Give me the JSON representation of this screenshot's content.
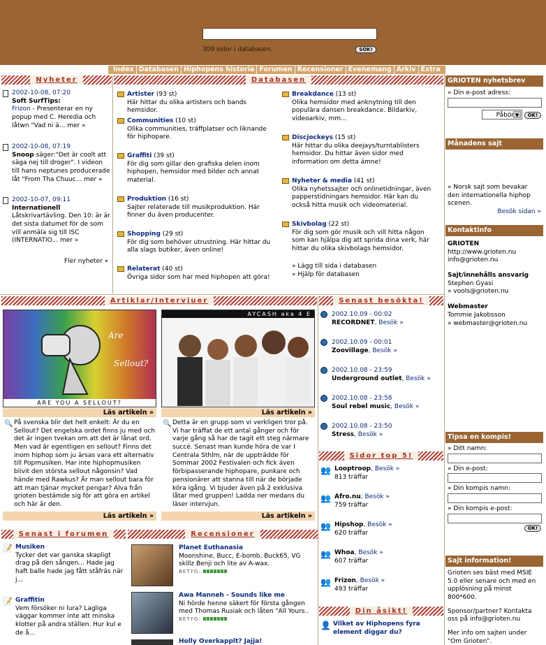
{
  "header": {
    "search_placeholder": "",
    "db_count": "309 sidor i databasen.",
    "search_button": "SÖK!"
  },
  "nav": [
    "Index",
    "Databasen",
    "Hiphopens historia",
    "Forumen",
    "Recensioner",
    "Evenemang",
    "Arkiv",
    "Extra"
  ],
  "sections": {
    "nyheter": "Nyheter",
    "databasen": "Databasen",
    "artiklar": "Artiklar/Intervjuer",
    "senast_besokta": "Senast besökta!",
    "sidor_top5": "Sidor top 5!",
    "senast_forumen": "Senast i forumen",
    "recensioner": "Recensioner",
    "din_asikt": "Din åsikt!"
  },
  "news": [
    {
      "date": "2002-10-08, 07:20",
      "title": "Soft SurfTips:",
      "link": "Frizon",
      "text": " - Presenterar en ny popup med C. Heredia och låtwn \"Vad ni ä... ",
      "more": "mer »"
    },
    {
      "date": "2002-10-08, 07:19",
      "title": "Snoop",
      "text2": " säger:\"Det är coolt att säga nej till droger\". I videon till hans neptunes producerade låt \"From Tha Chuuc... ",
      "more": "mer »"
    },
    {
      "date": "2002-10-07, 09:11",
      "title": "Internationell",
      "text": "Låtskrivartävling. Den 10: är är det sista datumet för de som vill anmäla sig till ISC (INTERNATIO... ",
      "more": "mer »"
    }
  ],
  "more_news": "Fler nyheter »",
  "db_left": [
    {
      "title": "Artister",
      "count": " (93 st)",
      "desc": "Här hittar du olika artisters och bands hemsidor."
    },
    {
      "title": "Communities",
      "count": " (10 st)",
      "desc": "Olika communities, träffplatser och liknande för hiphopare."
    },
    {
      "title": "Graffiti",
      "count": " (39 st)",
      "desc": "För dig som gillar den grafiska delen inom hiphopen, hemsidor med bilder och annat material."
    },
    {
      "title": "Produktion",
      "count": " (16 st)",
      "desc": "Sajter relaterade till musikproduktion. Här finner du även producenter."
    },
    {
      "title": "Shopping",
      "count": " (29 st)",
      "desc": "För dig som behöver utrustning. Här hittar du alla slags butiker, även online!"
    },
    {
      "title": "Relaterat",
      "count": " (40 st)",
      "desc": "Övriga sidor som har med hiphopen att göra!"
    }
  ],
  "db_right": [
    {
      "title": "Breakdance",
      "count": " (13 st)",
      "desc": "Olika hemsidor med anknytning till den populära dansen breakdance. Bildarkiv, videoarkiv, mm..."
    },
    {
      "title": "Discjockeys",
      "count": " (15 st)",
      "desc": "Här hittar du olika deejays/turntablisters hemsidor. Du hittar även sidor med information om detta ämne!"
    },
    {
      "title": "Nyheter & media",
      "count": " (41 st)",
      "desc": "Olika nyhetssajter och onlinetidningar, även papperstidningars hemsidor. Här kan du också hitta musik och videomaterial."
    },
    {
      "title": "Skivbolag",
      "count": " (22 st)",
      "desc": "För dig som gör musik och vill hitta någon som kan hjälpa dig att sprida dina verk, här hittar du olika skivbolags hemsidor."
    }
  ],
  "db_links": [
    "» Lägg till sida i databasen",
    "» Hjälp för databasen"
  ],
  "articles": [
    {
      "caption": "ARE YOU A SELLOUT?",
      "read": "Läs artikeln »",
      "text": "På svenska blir det helt enkelt: Är du en Sellout? Det engelska ordet finns ju med och det är ingen tvekan om att det är lånat ord. Men vad är egentligen en sellout? Finns det inom hiphop som ju ärsas vara ett alternativ till Popmusiken. Har inte hiphopmusiken blivit den största sellout någonsin? Vad hände med Rawkus? Är man sellout bara för att man tjänar mycket pengar? Alva från grioten bestämde sig för att göra en artikel och här är den.",
      "read2": "Läs artikeln »"
    },
    {
      "caption": "AYCASH   aka 4 E",
      "read": "Läs artikeln »",
      "text": "Detta är en grupp som vi verkligen tror på. Vi har träffat de ett antal gånger och för varje gång så har de tagit ett steg närmare succé. Senast man kunde höra de var I Centrala Sthlm, när de uppträdde för Sommar 2002 Festivalen och fick även förbipasserande hiphopare, punkare och pensionärer att stanna till när de började köra igång. Vi bjuder även på 2 exklusiva låtar med gruppen! Ladda ner medans du läser intervjun.",
      "read2": "Läs artikeln »"
    }
  ],
  "visited": [
    {
      "date": "2002.10.09 - 00:02",
      "name": "RECORDNET",
      "visit": ", Besök »"
    },
    {
      "date": "2002.10.09 - 00:01",
      "name": "Zoovillage",
      "visit": ", Besök »"
    },
    {
      "date": "2002.10.08 - 23:59",
      "name": "Underground outlet",
      "visit": ", Besök »"
    },
    {
      "date": "2002.10.08 - 23:58",
      "name": "Soul rebel music",
      "visit": ", Besök »"
    },
    {
      "date": "2002.10.08 - 23:50",
      "name": "Stress",
      "visit": ", Besök »"
    }
  ],
  "top5": [
    {
      "name": "Looptroop",
      "visit": ", Besök »",
      "hits": "813 träffar"
    },
    {
      "name": "Afro.nu",
      "visit": ", Besök »",
      "hits": "759 träffar"
    },
    {
      "name": "Hipshop",
      "visit": ", Besök »",
      "hits": "620 träffar"
    },
    {
      "name": "Whoa",
      "visit": ", Besök »",
      "hits": "607 träffar"
    },
    {
      "name": "Frizon",
      "visit": ", Besök »",
      "hits": "493 träffar"
    }
  ],
  "forum": [
    {
      "title": "Musiken",
      "text": "Tycker det var ganska skapligt drag på den sången... Hade jag haft balle hade jag fått ståfräs när j..."
    },
    {
      "title": "Graffitin",
      "text": "Vem försöker ni lura? Lagliga väggar kommer inte att minska klotter på andra ställen. Hur kul e de å..."
    }
  ],
  "reviews": [
    {
      "title": "Planet Euthanasia",
      "text": "Moonshine, Bucc, E-bomb, Buck65, VG skillz Benji och lite av A-wax.",
      "rating_label": "BETYG:",
      "rating": 7
    },
    {
      "title": "Awa Manneh - Sounds like me",
      "text": "Ni hörde henne säkert för första gången med Thomas Rusiak och låten \"All Yours..",
      "rating_label": "BETYG:",
      "rating": 7
    },
    {
      "title": "Holly Överkapplt? Jajja!",
      "text": "",
      "rating_label": "",
      "rating": 0
    }
  ],
  "opinion": {
    "question": "Vilket av Hiphopens fyra element diggar du?"
  },
  "right": {
    "newsletter_title": "GRIOTEN nyhetsbrev",
    "email_label": "» Din e-post adress:",
    "select_value": "Påbörja",
    "ok": "OK!",
    "month_title": "Månadens sajt",
    "month_text": "» Norsk sajt som bevakar den internationella hiphop scenen.",
    "month_link": "Besök sidan »",
    "contact_title": "Kontaktinfo",
    "contact_name": "GRIOTEN",
    "contact_url": "http://www.grioten.nu",
    "contact_mail": "info@grioten.nu",
    "resp_title": "Sajt/innehålls ansvarig",
    "resp_name": "Stephen Gyasi",
    "resp_mail": "» vools@grioten.nu",
    "web_title": "Webmaster",
    "web_name": "Tommie Jakobsson",
    "web_mail": "» webmaster@grioten.nu",
    "tip_title": "Tipsa en kompis!",
    "tip_name": "» Ditt namn:",
    "tip_email": "» Din e-post:",
    "tip_friend": "» Din kompis namn:",
    "tip_friend_email": "» Din kompis e-post:",
    "tip_ok": "OK!",
    "info_title": "Sajt information!",
    "info_text1": "Grioten ses bäst med MSIE 5.0 eller senare och med en upplösning på minst 800*600.",
    "info_text2": "Sponsor/partner? Kontakta oss på info@grioten.nu",
    "info_text3": "Mer info om sajten under \"Om Grioten\"."
  }
}
